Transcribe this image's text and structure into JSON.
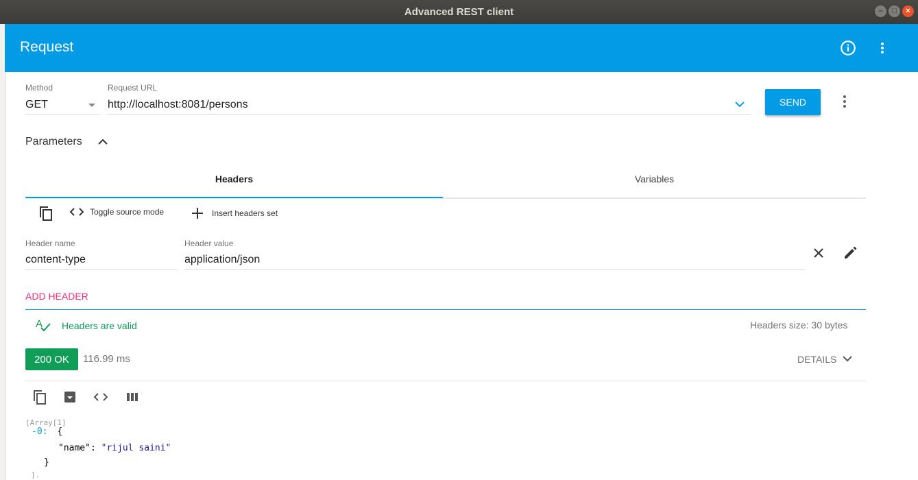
{
  "window": {
    "title": "Advanced REST client"
  },
  "appbar": {
    "title": "Request"
  },
  "request": {
    "method_label": "Method",
    "method_value": "GET",
    "url_label": "Request URL",
    "url_value": "http://localhost:8081/persons",
    "send_label": "SEND"
  },
  "parameters": {
    "label": "Parameters",
    "tabs": [
      {
        "label": "Headers"
      },
      {
        "label": "Variables"
      }
    ]
  },
  "headers_toolbar": {
    "toggle_source_label": "Toggle source mode",
    "insert_set_label": "Insert headers set"
  },
  "header_row": {
    "name_label": "Header name",
    "name_value": "content-type",
    "value_label": "Header value",
    "value_value": "application/json"
  },
  "add_header_label": "ADD HEADER",
  "validation": {
    "message": "Headers are valid",
    "size": "Headers size: 30 bytes"
  },
  "response": {
    "status": "200 OK",
    "time": "116.99 ms",
    "details_label": "DETAILS",
    "json": {
      "array_label": "[Array[1]",
      "index_label": "-0:",
      "open_brace": "{",
      "key": "\"name\"",
      "colon": ": ",
      "value": "\"rijul saini\"",
      "close_brace": "}",
      "tail": "]."
    }
  },
  "colors": {
    "accent": "#039be5",
    "success": "#0f9d58",
    "pink": "#ff2d6f"
  }
}
